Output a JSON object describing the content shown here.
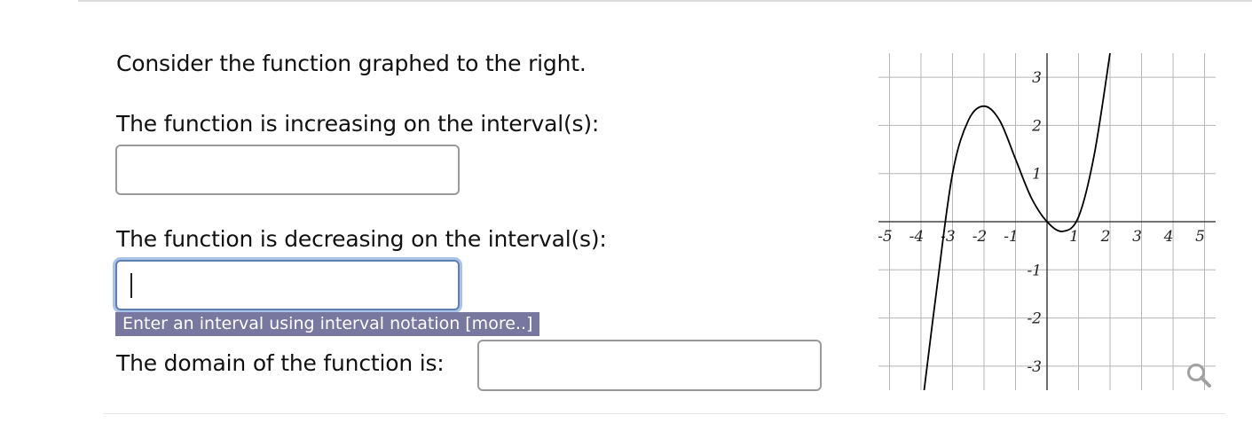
{
  "question": {
    "intro": "Consider the function graphed to the right.",
    "increasing_label": "The function is increasing on the interval(s):",
    "increasing_value": "",
    "decreasing_label": "The function is decreasing on the interval(s):",
    "decreasing_value": "",
    "hint": "Enter an interval using interval notation [more..]",
    "domain_label": "The domain of the function is:",
    "domain_value": ""
  },
  "chart_data": {
    "type": "line",
    "x_ticks": [
      "-5",
      "-4",
      "-3",
      "-2",
      "-1",
      "1",
      "2",
      "3",
      "4",
      "5"
    ],
    "y_ticks": [
      "3",
      "2",
      "1",
      "-1",
      "-2",
      "-3"
    ],
    "xlim": [
      -5,
      5
    ],
    "ylim": [
      -3.5,
      3.5
    ],
    "grid": true,
    "series": [
      {
        "x": [
          -3.9,
          -3.5,
          -3,
          -2.5,
          -2,
          -1.5,
          -1,
          -0.5,
          0,
          0.5,
          1,
          1.5,
          2
        ],
        "y": [
          -3.5,
          -1.4,
          1.0,
          2.1,
          2.4,
          2.1,
          1.3,
          0.5,
          0.0,
          -0.2,
          0.1,
          1.4,
          3.5
        ]
      }
    ],
    "color": "#000000"
  },
  "icons": {
    "zoom": "magnifier-icon"
  }
}
